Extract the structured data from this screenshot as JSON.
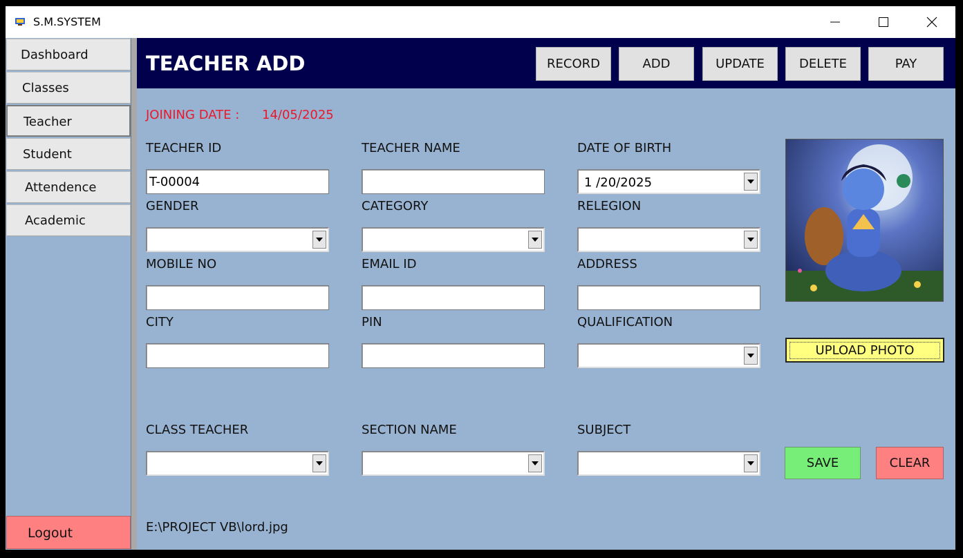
{
  "window": {
    "title": "S.M.SYSTEM"
  },
  "sidebar": {
    "items": [
      {
        "label": "Dashboard"
      },
      {
        "label": "Classes"
      },
      {
        "label": "Teacher"
      },
      {
        "label": "Student"
      },
      {
        "label": "Attendence"
      },
      {
        "label": "Academic"
      }
    ],
    "active": "Teacher",
    "logout_label": "Logout"
  },
  "header": {
    "title": "TEACHER ADD",
    "buttons": [
      {
        "label": "RECORD"
      },
      {
        "label": "ADD"
      },
      {
        "label": "UPDATE"
      },
      {
        "label": "DELETE"
      },
      {
        "label": "PAY"
      }
    ]
  },
  "form": {
    "joining_date_label": "JOINING DATE :",
    "joining_date_value": "14/05/2025",
    "teacher_id": {
      "label": "TEACHER ID",
      "value": "T-00004"
    },
    "teacher_name": {
      "label": "TEACHER NAME",
      "value": ""
    },
    "date_of_birth": {
      "label": "DATE OF BIRTH",
      "value": "1 /20/2025"
    },
    "gender": {
      "label": "GENDER",
      "value": ""
    },
    "category": {
      "label": "CATEGORY",
      "value": ""
    },
    "relegion": {
      "label": "RELEGION",
      "value": ""
    },
    "mobile_no": {
      "label": "MOBILE NO",
      "value": ""
    },
    "email_id": {
      "label": "EMAIL ID",
      "value": ""
    },
    "address": {
      "label": "ADDRESS",
      "value": ""
    },
    "city": {
      "label": "CITY",
      "value": ""
    },
    "pin": {
      "label": "PIN",
      "value": ""
    },
    "qualification": {
      "label": "QUALIFICATION",
      "value": ""
    },
    "class_teacher": {
      "label": "CLASS TEACHER",
      "value": ""
    },
    "section_name": {
      "label": "SECTION NAME",
      "value": ""
    },
    "subject": {
      "label": "SUBJECT",
      "value": ""
    }
  },
  "photo": {
    "upload_label": "UPLOAD PHOTO"
  },
  "actions": {
    "save_label": "SAVE",
    "clear_label": "CLEAR"
  },
  "photo_path": "E:\\PROJECT VB\\lord.jpg",
  "colors": {
    "header_bg": "#00004d",
    "content_bg": "#98b3d1",
    "joining_date": "#e8192c",
    "upload_button": "#ffff80",
    "save_button": "#77ee77",
    "clear_button": "#ff8080",
    "logout_button": "#ff8080"
  }
}
